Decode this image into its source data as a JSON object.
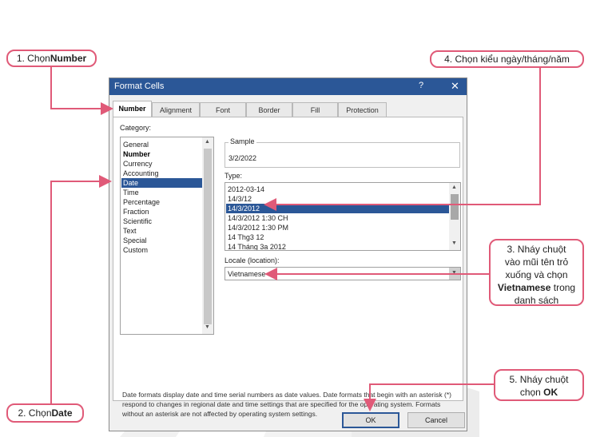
{
  "dialog": {
    "title": "Format Cells",
    "help_glyph": "?",
    "close_glyph": "✕",
    "tabs": [
      "Number",
      "Alignment",
      "Font",
      "Border",
      "Fill",
      "Protection"
    ],
    "category_label": "Category:",
    "categories": [
      "General",
      "Number",
      "Currency",
      "Accounting",
      "Date",
      "Time",
      "Percentage",
      "Fraction",
      "Scientific",
      "Text",
      "Special",
      "Custom"
    ],
    "selected_category": "Date",
    "sample_label": "Sample",
    "sample_value": "3/2/2022",
    "type_label": "Type:",
    "types": [
      "2012-03-14",
      "14/3/12",
      "14/3/2012",
      "14/3/2012 1:30 CH",
      "14/3/2012 1:30 PM",
      "14 Thg3 12",
      "14 Tháng 3a 2012"
    ],
    "selected_type": "14/3/2012",
    "locale_label": "Locale (location):",
    "locale_value": "Vietnamese",
    "description": "Date formats display date and time serial numbers as date values.  Date formats that begin with an asterisk (*) respond to changes in regional date and time settings that are specified for the operating system. Formats without an asterisk are not affected by operating system settings.",
    "ok_label": "OK",
    "cancel_label": "Cancel"
  },
  "callouts": {
    "c1_prefix": "1. Chọn ",
    "c1_bold": "Number",
    "c2_prefix": "2. Chọn ",
    "c2_bold": "Date",
    "c3_line1": "3. Nháy chuột",
    "c3_line2": "vào mũi tên trỏ",
    "c3_line3": "xuống và chọn",
    "c3_bold": "Vietnamese",
    "c3_line4_suffix": " trong",
    "c3_line5": "danh sách",
    "c4_text": "4. Chọn kiểu ngày/tháng/năm",
    "c5_line1": "5. Nháy chuột",
    "c5_prefix": "chọn ",
    "c5_bold": "OK"
  },
  "colors": {
    "callout_border": "#e05a78",
    "title_bar": "#2b5797",
    "selection": "#2b5797"
  }
}
